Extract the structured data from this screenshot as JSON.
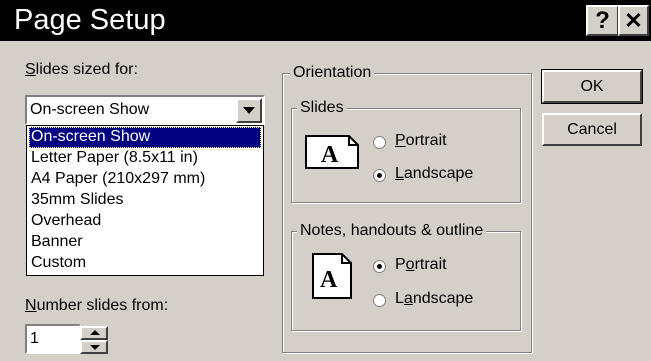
{
  "window": {
    "title": "Page Setup",
    "help_glyph": "?",
    "close_glyph": "✕"
  },
  "slides_sized_for": {
    "label_u": "S",
    "label_rest": "lides sized for:",
    "selected": "On-screen Show",
    "options": [
      "On-screen Show",
      "Letter Paper (8.5x11 in)",
      "A4 Paper (210x297 mm)",
      "35mm Slides",
      "Overhead",
      "Banner",
      "Custom"
    ]
  },
  "number_slides_from": {
    "label_u": "N",
    "label_rest": "umber slides from:",
    "value": "1"
  },
  "orientation": {
    "title": "Orientation",
    "slides": {
      "title": "Slides",
      "portrait_u": "P",
      "portrait_rest": "ortrait",
      "landscape_u": "L",
      "landscape_rest": "andscape",
      "selected": "landscape"
    },
    "notes": {
      "title": "Notes, handouts & outline",
      "portrait_pre": "P",
      "portrait_u": "o",
      "portrait_rest": "rtrait",
      "landscape_pre": "L",
      "landscape_u": "a",
      "landscape_rest": "ndscape",
      "selected": "portrait"
    },
    "icon_letter": "A"
  },
  "buttons": {
    "ok": "OK",
    "cancel": "Cancel"
  }
}
